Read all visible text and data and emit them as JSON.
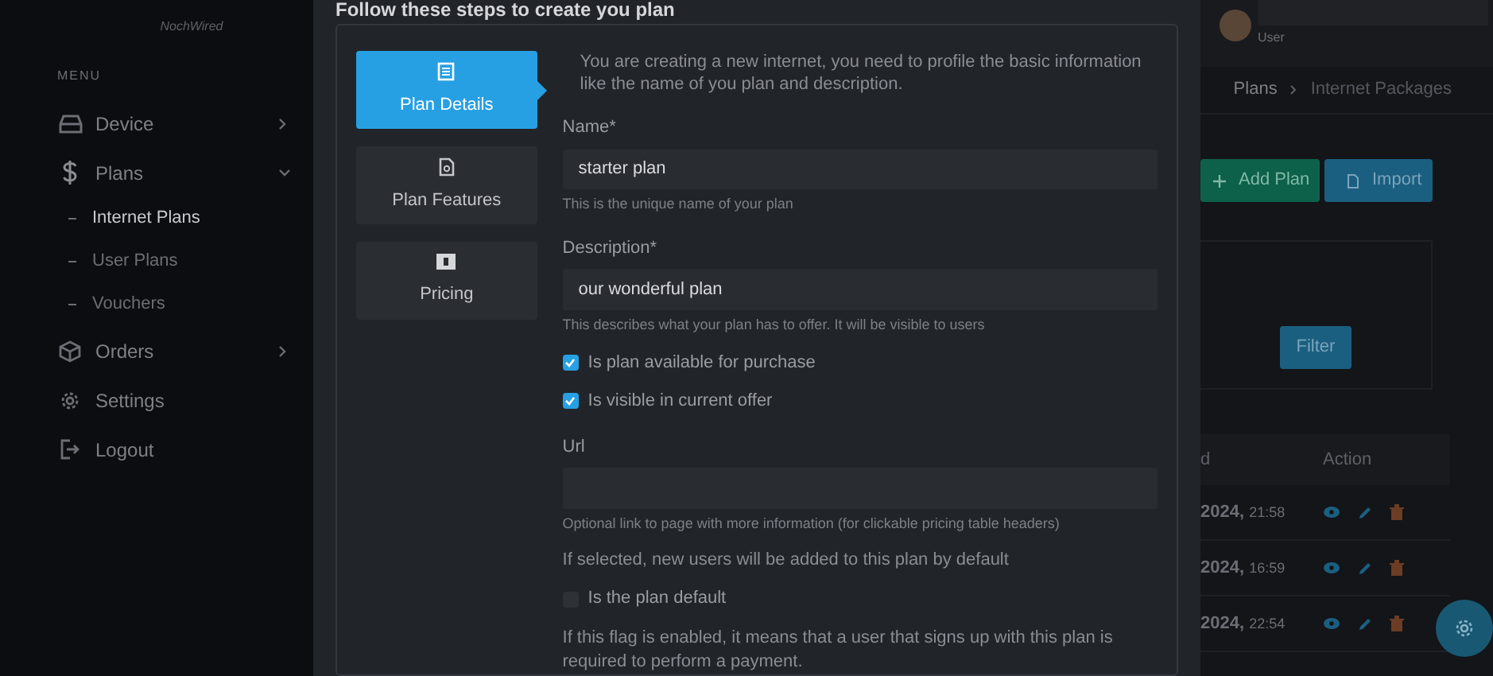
{
  "sidebar": {
    "logo": "NochWired",
    "menu_heading": "MENU",
    "items": [
      {
        "label": "Device",
        "kind": "group",
        "expanded": false,
        "selected": false
      },
      {
        "label": "Plans",
        "kind": "group",
        "expanded": true,
        "selected": false,
        "children": [
          {
            "label": "Internet Plans",
            "selected": true
          },
          {
            "label": "User Plans",
            "selected": false
          },
          {
            "label": "Vouchers",
            "selected": false
          }
        ]
      },
      {
        "label": "Orders",
        "kind": "group",
        "expanded": false,
        "selected": false
      },
      {
        "label": "Settings",
        "kind": "link",
        "selected": false
      },
      {
        "label": "Logout",
        "kind": "link",
        "selected": false
      }
    ]
  },
  "modal": {
    "title": "Follow these steps to create you plan",
    "steps": [
      {
        "label": "Plan Details",
        "selected": true
      },
      {
        "label": "Plan Features",
        "selected": false
      },
      {
        "label": "Pricing",
        "selected": false
      }
    ],
    "intro": "You are creating a new internet, you need to profile the basic information like the name of you plan and description.",
    "fields": [
      {
        "kind": "input",
        "label": "Name*",
        "value": "starter plan",
        "hint": "This is the unique name of your plan"
      },
      {
        "kind": "input",
        "label": "Description*",
        "value": "our wonderful plan",
        "hint": "This describes what your plan has to offer. It will be visible to users"
      },
      {
        "kind": "checkbox",
        "label": "Is plan available for purchase",
        "checked": true
      },
      {
        "kind": "checkbox",
        "label": "Is visible in current offer",
        "checked": true
      },
      {
        "kind": "input",
        "label": "Url",
        "hint": "Optional link to page with more information (for clickable pricing table headers)"
      },
      {
        "kind": "text",
        "text": "If selected, new users will be added to this plan by default"
      },
      {
        "kind": "checkbox",
        "label": "Is the plan default",
        "checked": false
      },
      {
        "kind": "text",
        "text": "If this flag is enabled, it means that a user that signs up with this plan is required to perform a payment."
      }
    ]
  },
  "background": {
    "user_role": "User",
    "breadcrumb": [
      "Plans",
      "Internet Packages"
    ],
    "buttons": [
      {
        "label": "Add Plan",
        "kind": "add"
      },
      {
        "label": "Import",
        "kind": "import"
      }
    ],
    "filter_button": "Filter",
    "table": {
      "columns": [
        "d",
        "Action"
      ],
      "rows": [
        {
          "date": "2024,",
          "time": "21:58"
        },
        {
          "date": "2024,",
          "time": "16:59"
        },
        {
          "date": "2024,",
          "time": "22:54"
        }
      ]
    }
  }
}
